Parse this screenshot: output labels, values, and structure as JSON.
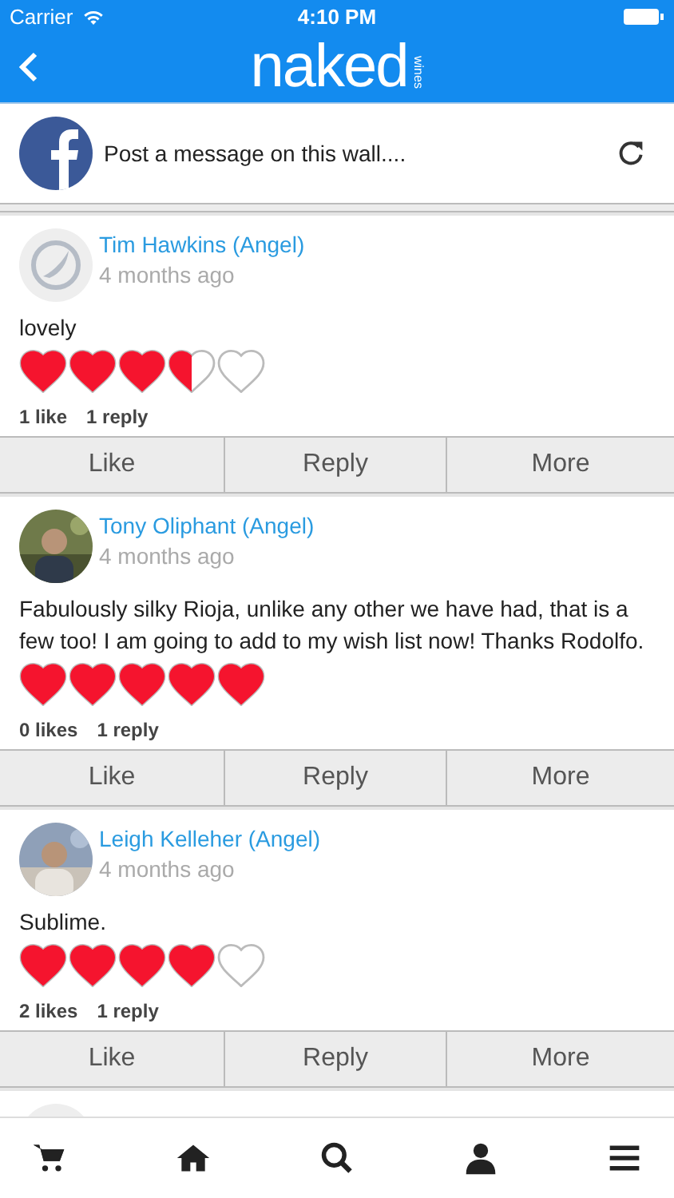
{
  "status_bar": {
    "carrier": "Carrier",
    "time": "4:10 PM"
  },
  "nav": {
    "logo": "naked",
    "logo_sub": "wines"
  },
  "post_bar": {
    "placeholder": "Post a message on this wall...."
  },
  "comments": [
    {
      "author": "Tim Hawkins (Angel)",
      "time": "4 months ago",
      "avatar": {
        "kind": "logo"
      },
      "text": "lovely",
      "stars": 3.5,
      "likes": "1 like",
      "replies": "1 reply",
      "actions": [
        "Like",
        "Reply",
        "More"
      ]
    },
    {
      "author": "Tony Oliphant (Angel)",
      "time": "4 months ago",
      "text": "Fabulously silky Rioja, unlike any other we have had, that is a few too! I am going to add to my wish list now! Thanks Rodolfo.",
      "stars": 5,
      "likes": "0 likes",
      "replies": "1 reply",
      "actions": [
        "Like",
        "Reply",
        "More"
      ]
    },
    {
      "author": "Leigh Kelleher (Angel)",
      "time": "4 months ago",
      "text": "Sublime.",
      "stars": 4,
      "likes": "2 likes",
      "replies": "1 reply",
      "actions": [
        "Like",
        "Reply",
        "More"
      ]
    }
  ],
  "tab_bar": [
    {
      "kind": "cart"
    },
    {
      "kind": "home"
    },
    {
      "kind": "search"
    },
    {
      "kind": "account"
    },
    {
      "kind": "menu"
    }
  ]
}
